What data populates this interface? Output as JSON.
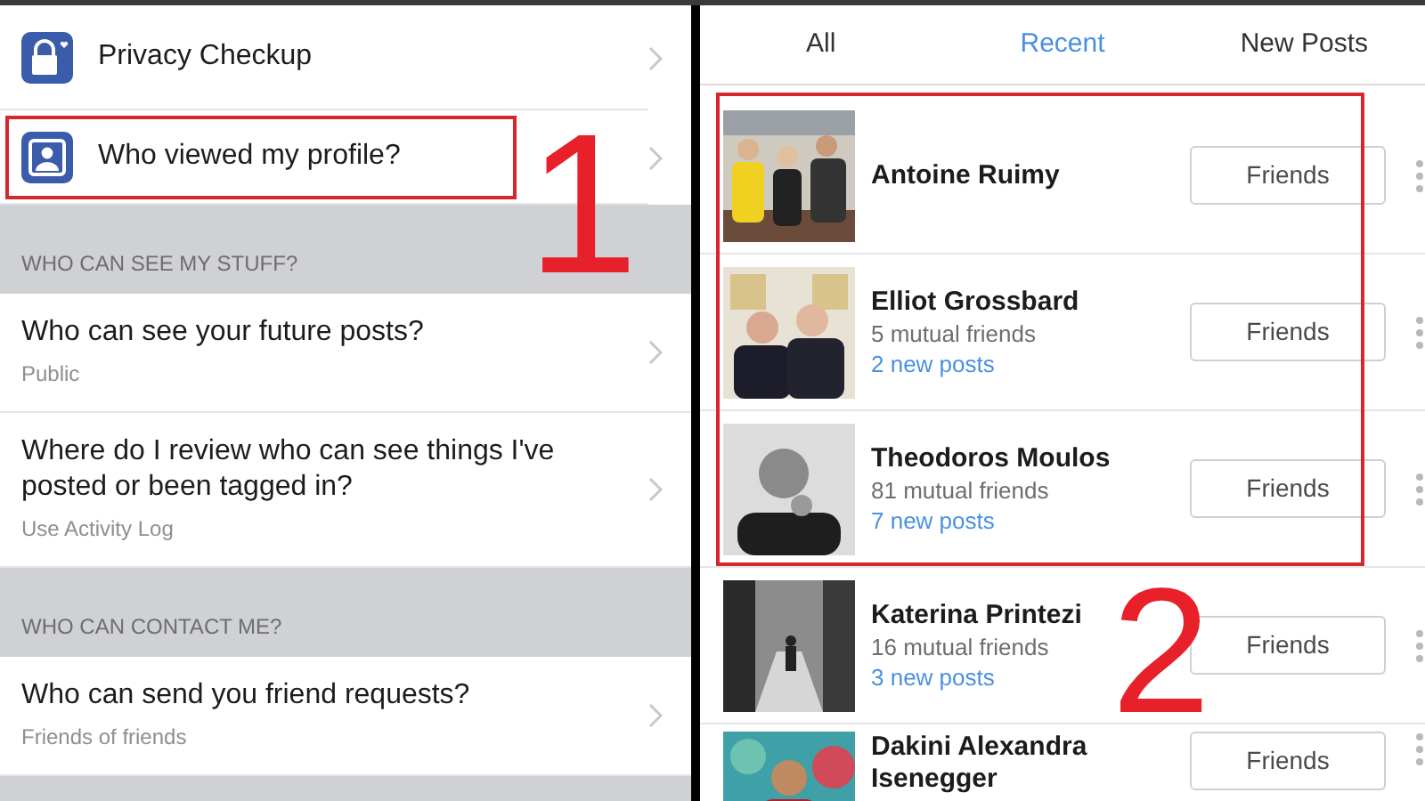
{
  "settings": {
    "items": [
      {
        "kind": "checkup",
        "title": "Privacy Checkup"
      },
      {
        "kind": "viewer",
        "title": "Who viewed my profile?"
      },
      {
        "kind": "header",
        "title": "WHO CAN SEE MY STUFF?"
      },
      {
        "kind": "option",
        "title": "Who can see your future posts?",
        "subtitle": "Public"
      },
      {
        "kind": "option",
        "title": "Where do I review who can see things I've posted or been tagged in?",
        "subtitle": "Use Activity Log"
      },
      {
        "kind": "header",
        "title": "WHO CAN CONTACT ME?"
      },
      {
        "kind": "option",
        "title": "Who can send you friend requests?",
        "subtitle": "Friends of friends"
      }
    ]
  },
  "friends": {
    "tabs": [
      {
        "label": "All",
        "selected": false
      },
      {
        "label": "Recent",
        "selected": true
      },
      {
        "label": "New Posts",
        "selected": false
      }
    ],
    "rows": [
      {
        "name": "Antoine Ruimy",
        "button": "Friends"
      },
      {
        "name": "Elliot Grossbard",
        "mutual": "5 mutual friends",
        "new_posts": "2 new posts",
        "button": "Friends"
      },
      {
        "name": "Theodoros Moulos",
        "mutual": "81 mutual friends",
        "new_posts": "7 new posts",
        "button": "Friends"
      },
      {
        "name": "Katerina Printezi",
        "mutual": "16 mutual friends",
        "new_posts": "3 new posts",
        "button": "Friends"
      },
      {
        "name": "Dakini Alexandra Isenegger",
        "button": "Friends"
      }
    ]
  },
  "annotations": [
    {
      "label": "1"
    },
    {
      "label": "2"
    }
  ]
}
